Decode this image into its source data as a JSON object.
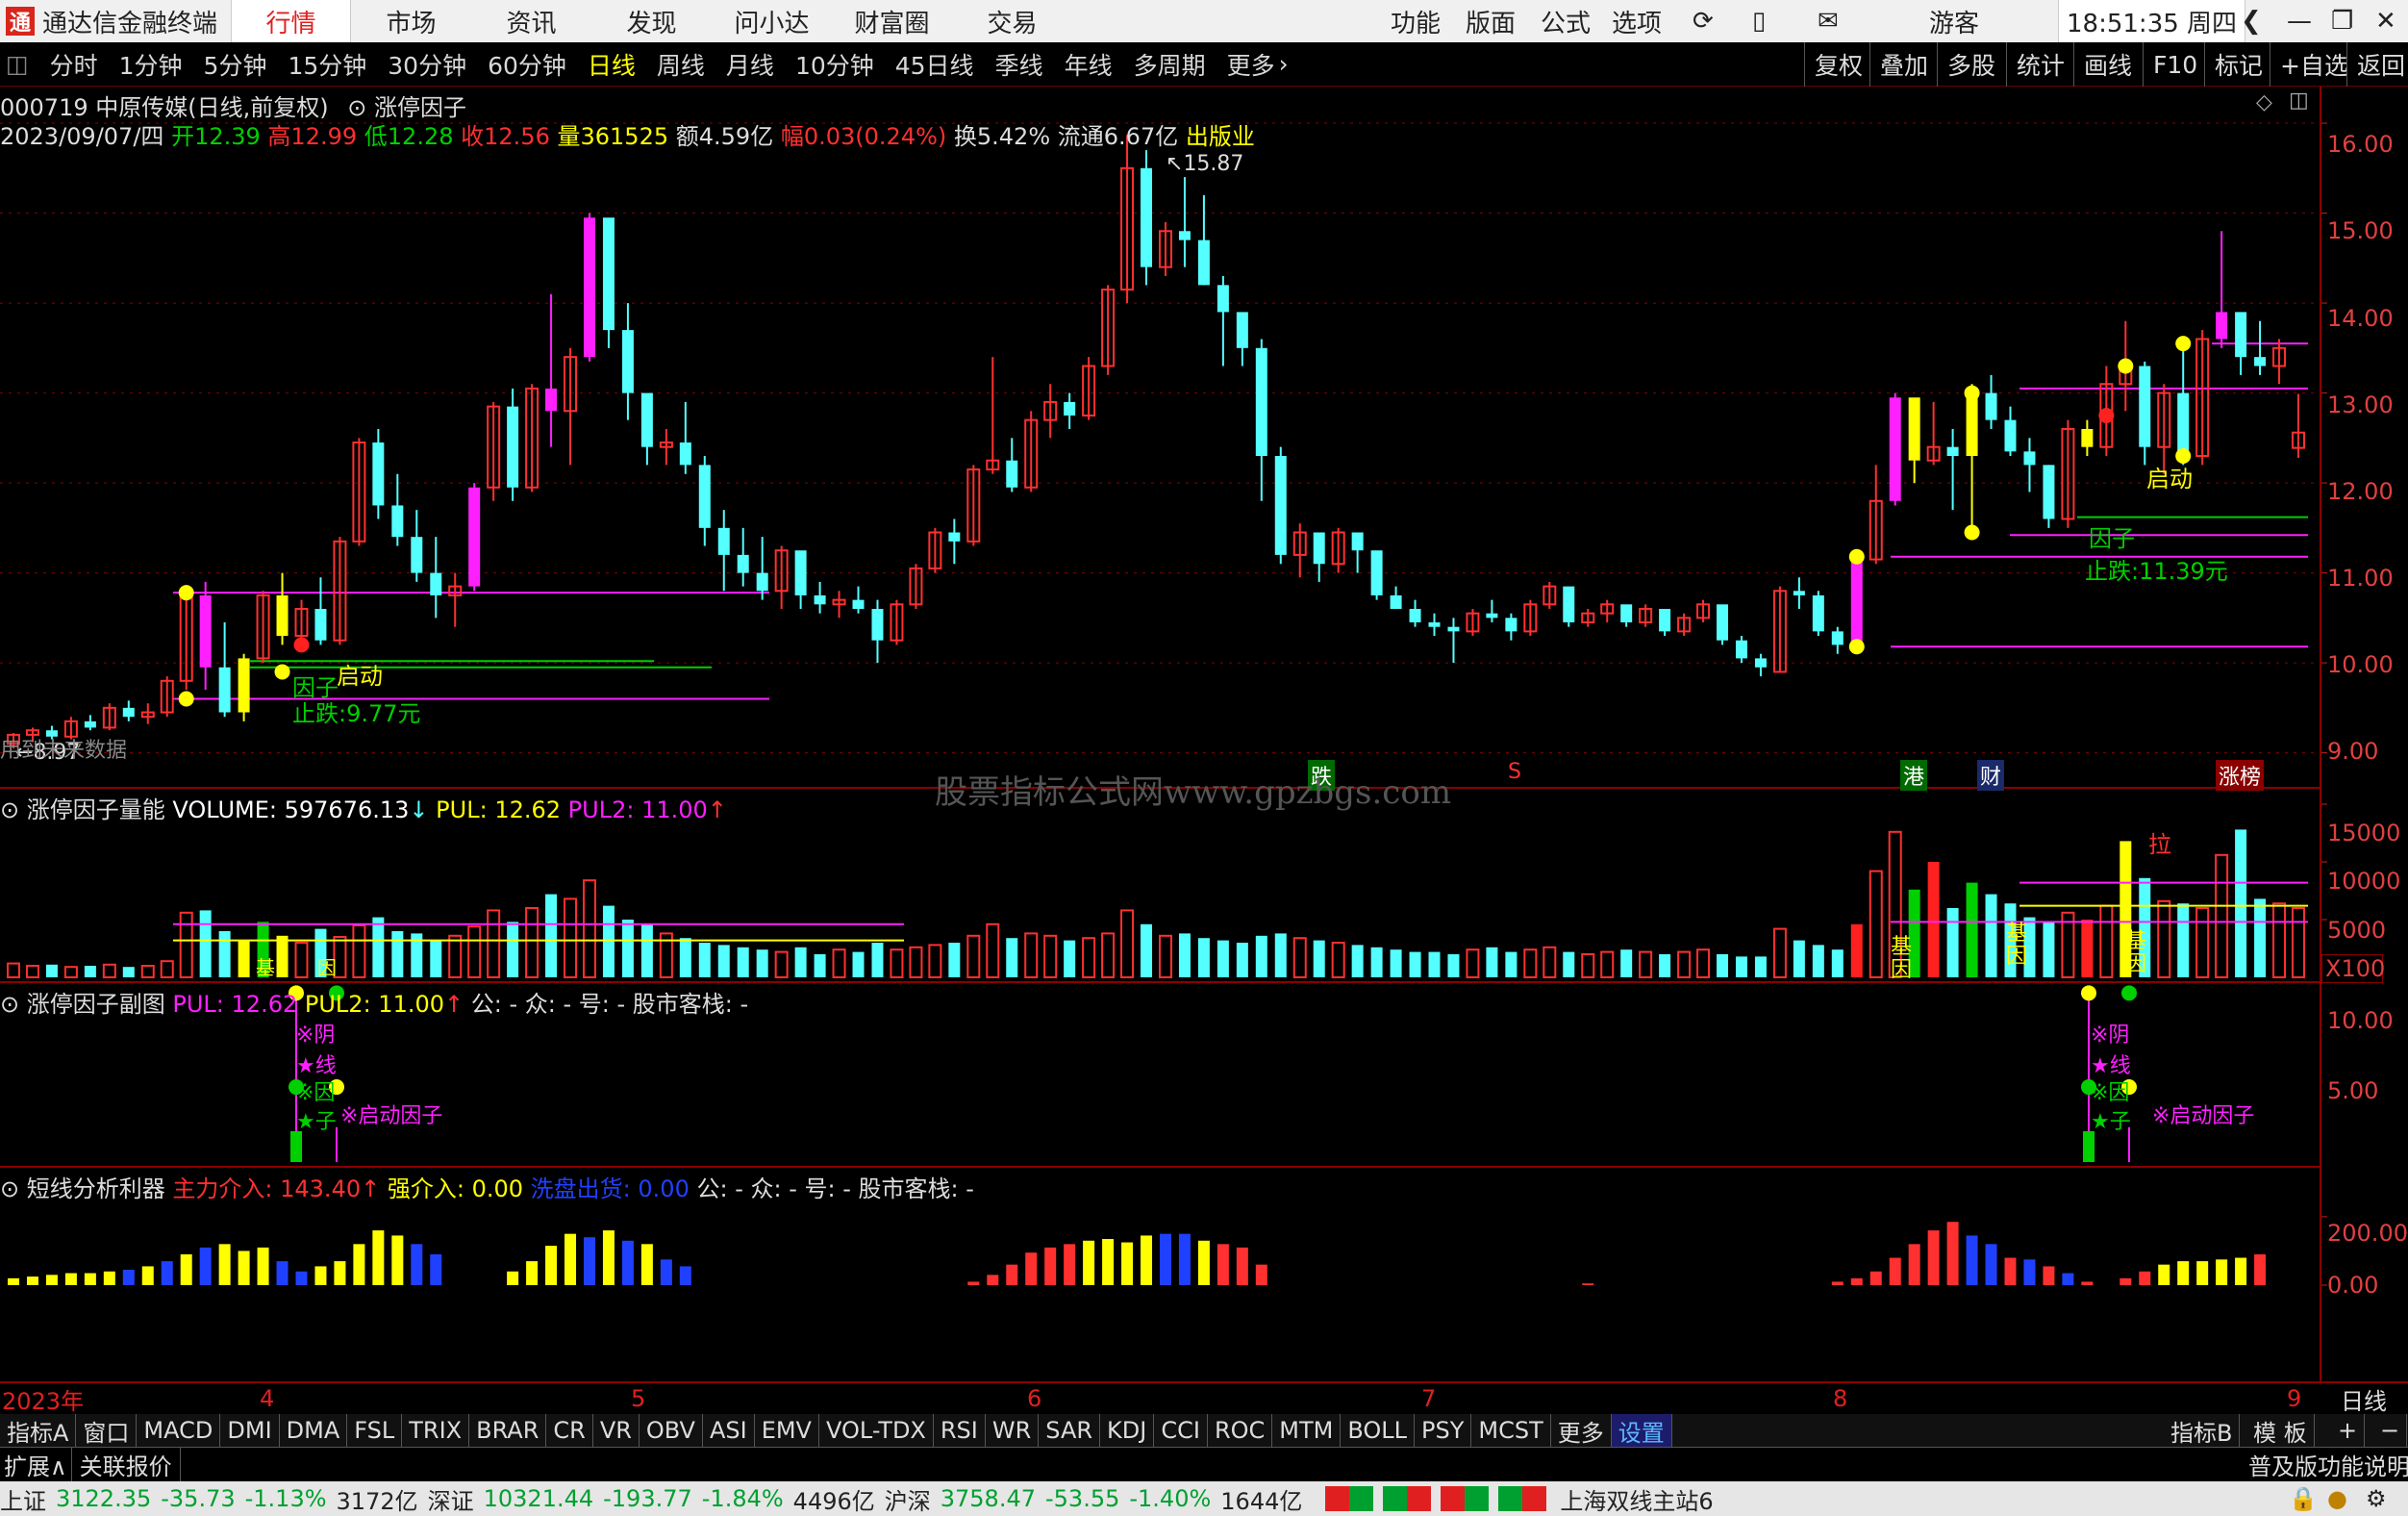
{
  "app": {
    "title": "通达信金融终端",
    "logo_char": "通"
  },
  "menu": {
    "items": [
      "行情",
      "市场",
      "资讯",
      "发现",
      "问小达",
      "财富圈",
      "交易"
    ],
    "active": "行情",
    "right_items": [
      "功能",
      "版面",
      "公式",
      "选项"
    ],
    "user": "游客",
    "clock": "18:51:35 周四"
  },
  "periods": {
    "items": [
      "分时",
      "1分钟",
      "5分钟",
      "15分钟",
      "30分钟",
      "60分钟",
      "日线",
      "周线",
      "月线",
      "10分钟",
      "45日线",
      "季线",
      "年线",
      "多周期",
      "更多"
    ],
    "active": "日线",
    "right_buttons": [
      "复权",
      "叠加",
      "多股",
      "统计",
      "画线",
      "F10",
      "标记",
      "+自选",
      "返回"
    ]
  },
  "stock": {
    "title": "000719 中原传媒(日线,前复权)",
    "indicator_name": "涨停因子",
    "date": "2023/09/07/四",
    "open_label": "开",
    "open": "12.39",
    "high_label": "高",
    "high": "12.99",
    "low_label": "低",
    "low": "12.28",
    "close_label": "收",
    "close": "12.56",
    "vol_label": "量",
    "vol": "361525",
    "amount_label": "额",
    "amount": "4.59亿",
    "change_label": "幅",
    "change": "0.03(0.24%)",
    "turnover_label": "换",
    "turnover": "5.42%",
    "float_label": "流通",
    "float": "6.67亿",
    "sector": "出版业"
  },
  "main_chart": {
    "y_ticks": [
      "16.00",
      "15.00",
      "14.00",
      "13.00",
      "12.00",
      "11.00",
      "10.00",
      "9.00"
    ],
    "high_marker": "15.87",
    "low_marker": "8.97",
    "annotations": {
      "start1": "启动",
      "factor1": "因子",
      "stop1": "止跌:9.77元",
      "start2": "启动",
      "factor2": "因子",
      "stop2": "止跌:11.39元"
    },
    "left_note": "用到未来数据",
    "event_tags": [
      "跌",
      "S",
      "港",
      "财",
      "涨榜"
    ],
    "watermark": "股票指标公式网www.gpzbgs.com"
  },
  "vol_panel": {
    "name": "涨停因子量能",
    "vol_label": "VOLUME:",
    "vol_value": "597676.13",
    "pul_label": "PUL:",
    "pul": "12.62",
    "pul2_label": "PUL2:",
    "pul2": "11.00",
    "y_ticks": [
      "15000",
      "10000",
      "5000"
    ],
    "unit": "X100",
    "marks": {
      "la": "拉",
      "ji": "基",
      "yin": "因"
    }
  },
  "sub_panel": {
    "name": "涨停因子副图",
    "pul_label": "PUL:",
    "pul": "12.62",
    "pul2_label": "PUL2:",
    "pul2": "11.00",
    "extra": "公: -  众: -  号: -  股市客栈: -",
    "y_ticks": [
      "10.00",
      "5.00"
    ],
    "labels": {
      "yin": "※阴",
      "xian": "★线",
      "yinz": "※因",
      "zi": "★子",
      "start": "※启动因子"
    }
  },
  "short_panel": {
    "name": "短线分析利器",
    "main_label": "主力介入:",
    "main_value": "143.40",
    "strong_label": "强介入:",
    "strong_value": "0.00",
    "wash_label": "洗盘出货:",
    "wash_value": "0.00",
    "extra": "公: -  众: -  号: -  股市客栈: -",
    "y_ticks": [
      "200.00",
      "0.00"
    ]
  },
  "date_axis": {
    "labels": [
      "2023年",
      "4",
      "5",
      "6",
      "7",
      "8",
      "9"
    ],
    "period": "日线"
  },
  "indicator_tabs": {
    "items": [
      "指标A",
      "窗口",
      "MACD",
      "DMI",
      "DMA",
      "FSL",
      "TRIX",
      "BRAR",
      "CR",
      "VR",
      "OBV",
      "ASI",
      "EMV",
      "VOL-TDX",
      "RSI",
      "WR",
      "SAR",
      "KDJ",
      "CCI",
      "ROC",
      "MTM",
      "BOLL",
      "PSY",
      "MCST",
      "更多",
      "设置"
    ],
    "active": "设置",
    "right": [
      "指标B",
      "模 板",
      "+",
      "−"
    ]
  },
  "ext_bar": {
    "expand": "扩展∧",
    "related": "关联报价",
    "right": "普及版功能说明"
  },
  "status": {
    "sh_label": "上证",
    "sh_value": "3122.35",
    "sh_change": "-35.73",
    "sh_pct": "-1.13%",
    "sh_amt": "3172亿",
    "sz_label": "深证",
    "sz_value": "10321.44",
    "sz_change": "-193.77",
    "sz_pct": "-1.84%",
    "sz_amt": "4496亿",
    "hs_label": "沪深",
    "hs_value": "3758.47",
    "hs_change": "-53.55",
    "hs_pct": "-1.40%",
    "hs_amt": "1644亿",
    "station": "上海双线主站6"
  },
  "colors": {
    "up": "#ff3030",
    "down": "#54ffff",
    "magenta": "#ff20ff",
    "yellow": "#ffff00",
    "blue": "#2040ff",
    "green": "#00d000"
  },
  "chart_data": {
    "type": "candlestick",
    "y_range": [
      8.6,
      16.3
    ],
    "candles": [
      [
        9.1,
        9.22,
        9.05,
        9.2
      ],
      [
        9.2,
        9.28,
        9.12,
        9.25
      ],
      [
        9.25,
        9.3,
        9.15,
        9.18
      ],
      [
        9.18,
        9.4,
        9.15,
        9.35
      ],
      [
        9.35,
        9.42,
        9.25,
        9.28
      ],
      [
        9.28,
        9.55,
        9.25,
        9.5
      ],
      [
        9.5,
        9.58,
        9.35,
        9.4
      ],
      [
        9.4,
        9.55,
        9.32,
        9.45
      ],
      [
        9.45,
        9.85,
        9.4,
        9.8
      ],
      [
        9.8,
        10.8,
        9.7,
        10.75
      ],
      [
        10.75,
        10.9,
        9.7,
        9.95
      ],
      [
        9.95,
        10.45,
        9.4,
        9.45
      ],
      [
        9.45,
        10.1,
        9.35,
        10.05
      ],
      [
        10.05,
        10.8,
        10.0,
        10.75
      ],
      [
        10.75,
        11.0,
        10.2,
        10.3
      ],
      [
        10.3,
        10.7,
        10.15,
        10.6
      ],
      [
        10.6,
        10.95,
        10.2,
        10.25
      ],
      [
        10.25,
        11.4,
        10.2,
        11.35
      ],
      [
        11.35,
        12.5,
        11.3,
        12.45
      ],
      [
        12.45,
        12.6,
        11.6,
        11.75
      ],
      [
        11.75,
        12.1,
        11.3,
        11.4
      ],
      [
        11.4,
        11.7,
        10.9,
        11.0
      ],
      [
        11.0,
        11.4,
        10.5,
        10.75
      ],
      [
        10.75,
        11.0,
        10.4,
        10.85
      ],
      [
        10.85,
        12.0,
        10.8,
        11.95
      ],
      [
        11.95,
        12.9,
        11.8,
        12.85
      ],
      [
        12.85,
        13.05,
        11.8,
        11.95
      ],
      [
        11.95,
        13.1,
        11.9,
        13.05
      ],
      [
        13.05,
        14.1,
        12.4,
        12.8
      ],
      [
        12.8,
        13.5,
        12.2,
        13.4
      ],
      [
        13.4,
        15.0,
        13.35,
        14.95
      ],
      [
        14.95,
        14.85,
        13.5,
        13.7
      ],
      [
        13.7,
        14.0,
        12.7,
        13.0
      ],
      [
        13.0,
        12.95,
        12.2,
        12.4
      ],
      [
        12.4,
        12.6,
        12.2,
        12.45
      ],
      [
        12.45,
        12.9,
        12.1,
        12.2
      ],
      [
        12.2,
        12.3,
        11.3,
        11.5
      ],
      [
        11.5,
        11.7,
        10.8,
        11.2
      ],
      [
        11.2,
        11.5,
        10.85,
        11.0
      ],
      [
        11.0,
        11.4,
        10.7,
        10.8
      ],
      [
        10.8,
        11.3,
        10.6,
        11.25
      ],
      [
        11.25,
        11.2,
        10.6,
        10.75
      ],
      [
        10.75,
        10.9,
        10.55,
        10.65
      ],
      [
        10.65,
        10.8,
        10.5,
        10.7
      ],
      [
        10.7,
        10.85,
        10.55,
        10.6
      ],
      [
        10.6,
        10.7,
        10.0,
        10.25
      ],
      [
        10.25,
        10.7,
        10.2,
        10.65
      ],
      [
        10.65,
        11.1,
        10.6,
        11.05
      ],
      [
        11.05,
        11.5,
        11.0,
        11.45
      ],
      [
        11.45,
        11.6,
        11.1,
        11.35
      ],
      [
        11.35,
        12.2,
        11.3,
        12.15
      ],
      [
        12.15,
        13.4,
        12.1,
        12.25
      ],
      [
        12.25,
        12.5,
        11.9,
        11.95
      ],
      [
        11.95,
        12.8,
        11.9,
        12.7
      ],
      [
        12.7,
        13.1,
        12.5,
        12.9
      ],
      [
        12.9,
        13.0,
        12.6,
        12.75
      ],
      [
        12.75,
        13.4,
        12.7,
        13.3
      ],
      [
        13.3,
        14.2,
        13.2,
        14.15
      ],
      [
        14.15,
        15.87,
        14.0,
        15.5
      ],
      [
        15.5,
        15.7,
        14.2,
        14.4
      ],
      [
        14.4,
        14.9,
        14.3,
        14.8
      ],
      [
        14.8,
        15.4,
        14.4,
        14.7
      ],
      [
        14.7,
        15.2,
        14.2,
        14.2
      ],
      [
        14.2,
        14.3,
        13.3,
        13.9
      ],
      [
        13.9,
        13.75,
        13.3,
        13.5
      ],
      [
        13.5,
        13.6,
        11.8,
        12.3
      ],
      [
        12.3,
        12.4,
        11.1,
        11.2
      ],
      [
        11.2,
        11.55,
        10.95,
        11.45
      ],
      [
        11.45,
        11.3,
        10.9,
        11.1
      ],
      [
        11.1,
        11.5,
        11.0,
        11.45
      ],
      [
        11.45,
        11.4,
        11.0,
        11.25
      ],
      [
        11.25,
        11.1,
        10.7,
        10.75
      ],
      [
        10.75,
        10.85,
        10.6,
        10.6
      ],
      [
        10.6,
        10.7,
        10.4,
        10.45
      ],
      [
        10.45,
        10.55,
        10.3,
        10.4
      ],
      [
        10.4,
        10.5,
        10.0,
        10.35
      ],
      [
        10.35,
        10.6,
        10.3,
        10.55
      ],
      [
        10.55,
        10.7,
        10.45,
        10.5
      ],
      [
        10.5,
        10.55,
        10.25,
        10.35
      ],
      [
        10.35,
        10.7,
        10.3,
        10.65
      ],
      [
        10.65,
        10.9,
        10.6,
        10.85
      ],
      [
        10.85,
        10.8,
        10.4,
        10.45
      ],
      [
        10.45,
        10.6,
        10.4,
        10.55
      ],
      [
        10.55,
        10.7,
        10.45,
        10.65
      ],
      [
        10.65,
        10.6,
        10.4,
        10.45
      ],
      [
        10.45,
        10.65,
        10.4,
        10.6
      ],
      [
        10.6,
        10.55,
        10.3,
        10.35
      ],
      [
        10.35,
        10.55,
        10.3,
        10.5
      ],
      [
        10.5,
        10.7,
        10.45,
        10.65
      ],
      [
        10.65,
        10.6,
        10.2,
        10.25
      ],
      [
        10.25,
        10.3,
        10.0,
        10.05
      ],
      [
        10.05,
        10.1,
        9.85,
        9.95
      ],
      [
        9.9,
        10.85,
        9.9,
        10.8
      ],
      [
        10.8,
        10.95,
        10.6,
        10.75
      ],
      [
        10.75,
        10.8,
        10.3,
        10.35
      ],
      [
        10.35,
        10.4,
        10.1,
        10.2
      ],
      [
        10.2,
        11.2,
        10.1,
        11.15
      ],
      [
        11.15,
        12.2,
        11.1,
        11.8
      ],
      [
        11.8,
        13.0,
        11.75,
        12.95
      ],
      [
        12.95,
        12.7,
        12.0,
        12.25
      ],
      [
        12.25,
        12.9,
        12.2,
        12.4
      ],
      [
        12.4,
        12.6,
        11.7,
        12.3
      ],
      [
        12.3,
        13.1,
        11.4,
        13.0
      ],
      [
        13.0,
        13.2,
        12.6,
        12.7
      ],
      [
        12.7,
        12.85,
        12.3,
        12.35
      ],
      [
        12.35,
        12.5,
        11.9,
        12.2
      ],
      [
        12.2,
        12.2,
        11.5,
        11.6
      ],
      [
        11.6,
        12.7,
        11.5,
        12.6
      ],
      [
        12.6,
        12.7,
        12.3,
        12.4
      ],
      [
        12.4,
        13.3,
        12.3,
        13.1
      ],
      [
        13.1,
        13.8,
        12.8,
        13.3
      ],
      [
        13.3,
        13.35,
        12.2,
        12.4
      ],
      [
        12.4,
        13.1,
        12.1,
        13.0
      ],
      [
        13.0,
        13.6,
        12.2,
        12.3
      ],
      [
        12.3,
        13.7,
        12.2,
        13.6
      ],
      [
        13.6,
        14.8,
        13.5,
        13.9
      ],
      [
        13.9,
        13.7,
        13.2,
        13.4
      ],
      [
        13.4,
        13.8,
        13.2,
        13.3
      ],
      [
        13.3,
        13.6,
        13.1,
        13.5
      ],
      [
        12.39,
        12.99,
        12.28,
        12.56
      ]
    ],
    "volumes": [
      1.2,
      1.0,
      1.1,
      0.9,
      1.0,
      1.1,
      0.9,
      1.0,
      1.4,
      5.6,
      5.8,
      4.0,
      3.2,
      4.8,
      3.6,
      3.0,
      4.2,
      3.5,
      4.5,
      5.2,
      4.0,
      3.8,
      3.2,
      3.6,
      4.4,
      5.8,
      4.8,
      6.0,
      7.2,
      6.8,
      8.4,
      6.2,
      5.0,
      4.6,
      3.8,
      3.4,
      3.0,
      2.8,
      2.6,
      2.4,
      2.2,
      2.6,
      2.0,
      2.4,
      2.2,
      3.0,
      2.4,
      2.6,
      2.8,
      3.0,
      3.6,
      4.6,
      3.4,
      3.8,
      3.6,
      3.2,
      3.4,
      3.8,
      5.8,
      4.6,
      3.6,
      3.8,
      3.4,
      3.2,
      3.0,
      3.6,
      3.8,
      3.4,
      3.2,
      3.0,
      2.8,
      2.6,
      2.4,
      2.2,
      2.2,
      2.0,
      2.4,
      2.6,
      2.2,
      2.4,
      2.6,
      2.2,
      2.0,
      2.2,
      2.4,
      2.2,
      2.0,
      2.2,
      2.4,
      2.0,
      1.8,
      1.8,
      4.2,
      3.2,
      2.8,
      2.4,
      4.6,
      9.2,
      12.6,
      7.6,
      10.0,
      6.0,
      8.2,
      7.2,
      6.4,
      5.2,
      4.8,
      5.6,
      5.0,
      6.2,
      11.8,
      8.6,
      6.6,
      6.4,
      6.0,
      10.6,
      12.8,
      6.8,
      6.4,
      6.0
    ]
  }
}
